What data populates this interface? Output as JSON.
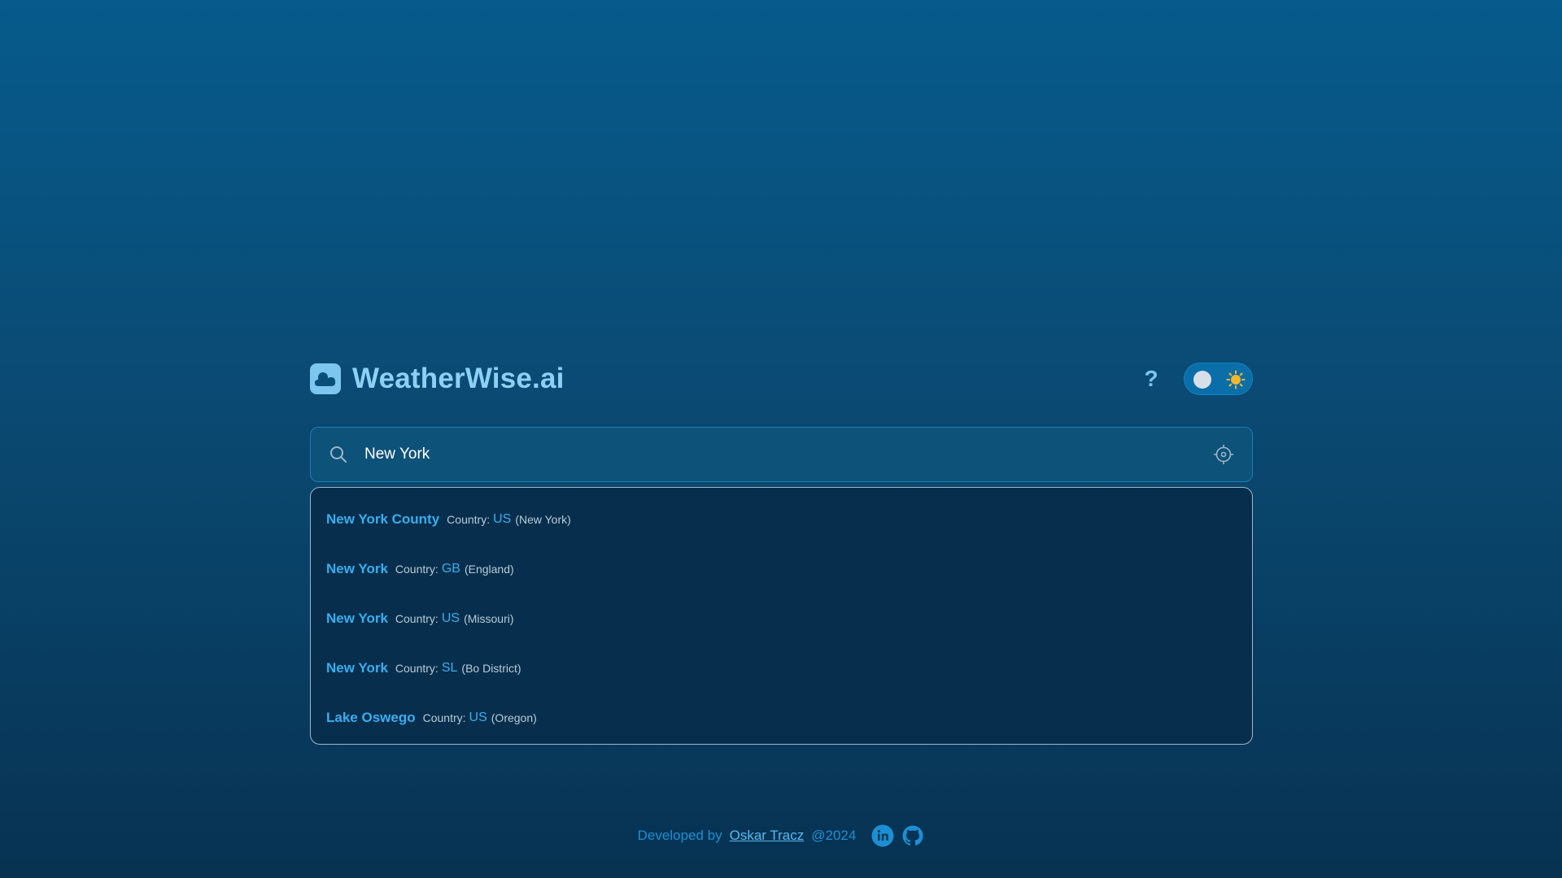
{
  "header": {
    "brand_title": "WeatherWise.ai",
    "help_label": "?"
  },
  "search": {
    "value": "New York",
    "placeholder": ""
  },
  "suggestions": [
    {
      "name": "New York County",
      "country_label": "Country:",
      "code": "US",
      "region": "(New York)"
    },
    {
      "name": "New York",
      "country_label": "Country:",
      "code": "GB",
      "region": "(England)"
    },
    {
      "name": "New York",
      "country_label": "Country:",
      "code": "US",
      "region": "(Missouri)"
    },
    {
      "name": "New York",
      "country_label": "Country:",
      "code": "SL",
      "region": "(Bo District)"
    },
    {
      "name": "Lake Oswego",
      "country_label": "Country:",
      "code": "US",
      "region": "(Oregon)"
    }
  ],
  "footer": {
    "developed_by": "Developed by",
    "author": "Oskar Tracz",
    "year": "@2024"
  },
  "icons": {
    "logo": "cloud-icon",
    "theme_toggle": "sun-icon",
    "search": "search-icon",
    "locate": "crosshair-icon",
    "social": [
      "linkedin-icon",
      "github-icon"
    ]
  },
  "colors": {
    "accent": "#38aef0",
    "brand": "#8dd0f5",
    "sun": "#f5b82e"
  }
}
